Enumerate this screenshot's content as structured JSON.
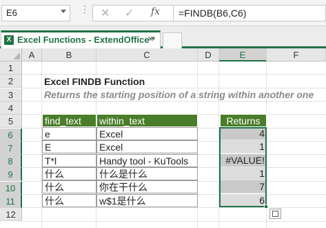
{
  "formula_bar": {
    "name_box": "E6",
    "cancel_icon": "✕",
    "enter_icon": "✓",
    "fx_icon": "fx",
    "formula": "=FINDB(B6,C6)"
  },
  "tab": {
    "title": "Excel Functions - ExtendOffice *",
    "close_icon": "×"
  },
  "columns": [
    "A",
    "B",
    "C",
    "D",
    "E",
    "F"
  ],
  "rows": [
    "1",
    "2",
    "3",
    "4",
    "5",
    "6",
    "7",
    "8",
    "9",
    "10",
    "11",
    "12"
  ],
  "sheet": {
    "title": "Excel FINDB Function",
    "subtitle": "Returns the starting position of a string within another one",
    "table_headers": [
      "find_text",
      "within_text"
    ],
    "returns_header": "Returns",
    "table_rows": [
      [
        "e",
        "Excel"
      ],
      [
        "E",
        "Excel"
      ],
      [
        "T*l",
        "Handy tool - KuTools"
      ],
      [
        "什么",
        "什么是什么"
      ],
      [
        "什么",
        "你在干什么"
      ],
      [
        "什么",
        "w$1是什么"
      ]
    ],
    "returns": [
      "4",
      "1",
      "#VALUE!",
      "1",
      "7",
      "6"
    ]
  },
  "colors": {
    "accent": "#1f7245",
    "header_green": "#4a7d2a"
  }
}
